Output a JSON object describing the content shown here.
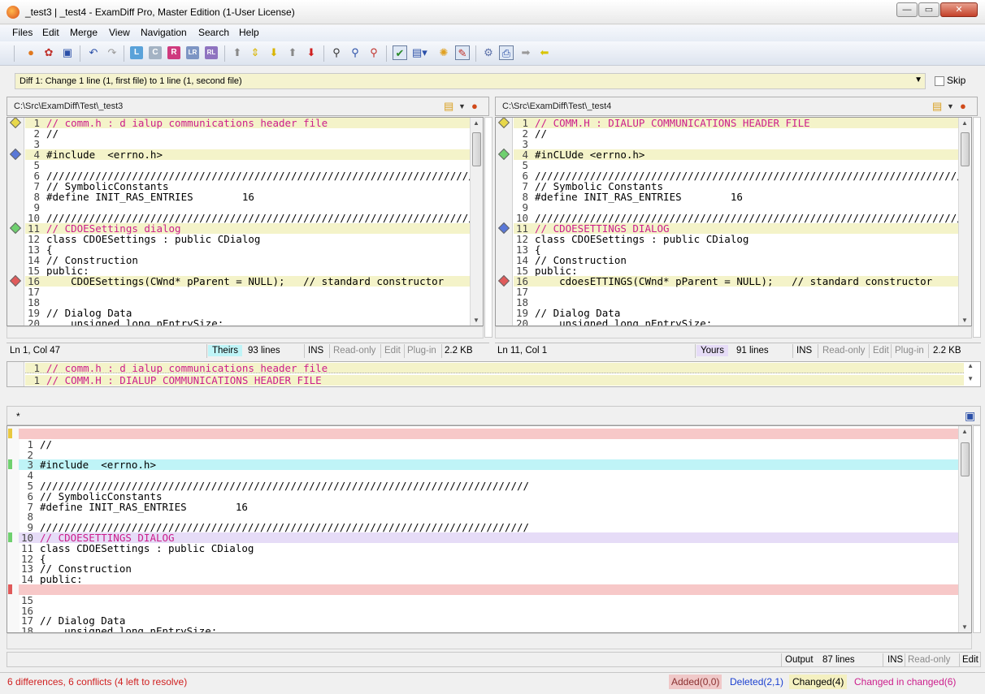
{
  "window": {
    "title": "_test3  |  _test4 - ExamDiff Pro, Master Edition (1-User License)",
    "min_glyph": "—",
    "max_glyph": "▭",
    "close_glyph": "✕"
  },
  "menu": [
    "Files",
    "Edit",
    "Merge",
    "View",
    "Navigation",
    "Search",
    "Help"
  ],
  "toolbar": {
    "icons": [
      "open-icon",
      "compare-icon",
      "save-icon",
      "undo-icon",
      "redo-icon",
      "L",
      "C",
      "R",
      "LR",
      "RL",
      "up-icon",
      "next-diff-icon",
      "down-icon",
      "first-icon",
      "last-icon",
      "find-icon",
      "find-next-icon",
      "find-prev-icon",
      "check-icon",
      "options-icon",
      "sync-icon",
      "edit-icon",
      "tools-icon",
      "print-icon",
      "right-arrow-icon",
      "left-arrow-icon"
    ],
    "box_colors": {
      "L": "#5aa2d9",
      "C": "#a4b3c4",
      "R": "#cf3a7e",
      "LR": "#7d95c4",
      "RL": "#8f73c0"
    }
  },
  "diffbar": {
    "text": "Diff 1: Change 1 line (1, first file) to 1 line (1, second file)",
    "skip_label": "Skip"
  },
  "left": {
    "path": "C:\\Src\\ExamDiff\\Test\\_test3",
    "path_bg": "#bff4f7",
    "rows": [
      {
        "n": "1",
        "t": "// comm.h : d ialup communications header file",
        "hl": "yel",
        "mag": true
      },
      {
        "n": "2",
        "t": "//",
        "hl": ""
      },
      {
        "n": "3",
        "t": "",
        "hl": ""
      },
      {
        "n": "4",
        "t": "#include  <errno.h>",
        "hl": "yel"
      },
      {
        "n": "5",
        "t": "",
        "hl": ""
      },
      {
        "n": "6",
        "t": "////////////////////////////////////////////////////////////////////////////////",
        "hl": ""
      },
      {
        "n": "7",
        "t": "// SymbolicConstants",
        "hl": ""
      },
      {
        "n": "8",
        "t": "#define INIT_RAS_ENTRIES        16",
        "hl": ""
      },
      {
        "n": "9",
        "t": "",
        "hl": ""
      },
      {
        "n": "10",
        "t": "////////////////////////////////////////////////////////////////////////////////",
        "hl": ""
      },
      {
        "n": "11",
        "t": "// CDOESettings dialog",
        "hl": "yel",
        "mag": true
      },
      {
        "n": "12",
        "t": "class CDOESettings : public CDialog",
        "hl": ""
      },
      {
        "n": "13",
        "t": "{",
        "hl": ""
      },
      {
        "n": "14",
        "t": "// Construction",
        "hl": ""
      },
      {
        "n": "15",
        "t": "public:",
        "hl": ""
      },
      {
        "n": "16",
        "t": "    CDOESettings(CWnd* pParent = NULL);   // standard constructor",
        "hl": "yel"
      },
      {
        "n": "17",
        "t": "",
        "hl": ""
      },
      {
        "n": "18",
        "t": "",
        "hl": ""
      },
      {
        "n": "19",
        "t": "// Dialog Data",
        "hl": ""
      },
      {
        "n": "20",
        "t": "    unsigned long nEntrySize;",
        "hl": ""
      }
    ],
    "status": {
      "pos": "Ln 1, Col 47",
      "label": "Theirs",
      "label_bg": "#bff4f7",
      "lines": "93 lines",
      "ins": "INS",
      "ro": "Read-only",
      "edit": "Edit",
      "plugin": "Plug-in",
      "size": "2.2 KB"
    }
  },
  "right": {
    "path": "C:\\Src\\ExamDiff\\Test\\_test4",
    "path_bg": "#e6dcf7",
    "rows": [
      {
        "n": "1",
        "t": "// COMM.H : DIALUP COMMUNICATIONS HEADER FILE",
        "hl": "yel",
        "mag": true
      },
      {
        "n": "2",
        "t": "//",
        "hl": ""
      },
      {
        "n": "3",
        "t": "",
        "hl": ""
      },
      {
        "n": "4",
        "t": "#inCLUde <errno.h>",
        "hl": "yel"
      },
      {
        "n": "5",
        "t": "",
        "hl": ""
      },
      {
        "n": "6",
        "t": "////////////////////////////////////////////////////////////////////////////////",
        "hl": ""
      },
      {
        "n": "7",
        "t": "// Symbolic Constants",
        "hl": ""
      },
      {
        "n": "8",
        "t": "#define INIT_RAS_ENTRIES        16",
        "hl": ""
      },
      {
        "n": "9",
        "t": "",
        "hl": ""
      },
      {
        "n": "10",
        "t": "////////////////////////////////////////////////////////////////////////////////",
        "hl": ""
      },
      {
        "n": "11",
        "t": "// CDOESETTINGS DIALOG",
        "hl": "yel",
        "mag": true
      },
      {
        "n": "12",
        "t": "class CDOESettings : public CDialog",
        "hl": ""
      },
      {
        "n": "13",
        "t": "{",
        "hl": ""
      },
      {
        "n": "14",
        "t": "// Construction",
        "hl": ""
      },
      {
        "n": "15",
        "t": "public:",
        "hl": ""
      },
      {
        "n": "16",
        "t": "    cdoesETTINGS(CWnd* pParent = NULL);   // standard constructor",
        "hl": "yel"
      },
      {
        "n": "17",
        "t": "",
        "hl": ""
      },
      {
        "n": "18",
        "t": "",
        "hl": ""
      },
      {
        "n": "19",
        "t": "// Dialog Data",
        "hl": ""
      },
      {
        "n": "20",
        "t": "    unsigned long nEntrySize;",
        "hl": ""
      }
    ],
    "status": {
      "pos": "Ln 11, Col 1",
      "label": "Yours",
      "label_bg": "#e6dcf7",
      "lines": "91 lines",
      "ins": "INS",
      "ro": "Read-only",
      "edit": "Edit",
      "plugin": "Plug-in",
      "size": "2.2 KB"
    }
  },
  "compare_rows": [
    {
      "n": "1",
      "t": "// comm.h : d ialup communications header file"
    },
    {
      "n": "1",
      "t": "// COMM.H : DIALUP COMMUNICATIONS HEADER FILE"
    }
  ],
  "output": {
    "tab": "*",
    "rows": [
      {
        "n": "",
        "t": "",
        "hl": "pink"
      },
      {
        "n": "1",
        "t": "//",
        "hl": ""
      },
      {
        "n": "2",
        "t": "",
        "hl": ""
      },
      {
        "n": "3",
        "t": "#include  <errno.h>",
        "hl": "cyan"
      },
      {
        "n": "4",
        "t": "",
        "hl": ""
      },
      {
        "n": "5",
        "t": "////////////////////////////////////////////////////////////////////////////////",
        "hl": ""
      },
      {
        "n": "6",
        "t": "// SymbolicConstants",
        "hl": ""
      },
      {
        "n": "7",
        "t": "#define INIT_RAS_ENTRIES        16",
        "hl": ""
      },
      {
        "n": "8",
        "t": "",
        "hl": ""
      },
      {
        "n": "9",
        "t": "////////////////////////////////////////////////////////////////////////////////",
        "hl": ""
      },
      {
        "n": "10",
        "t": "// CDOESETTINGS DIALOG",
        "hl": "lav",
        "mag": true
      },
      {
        "n": "11",
        "t": "class CDOESettings : public CDialog",
        "hl": ""
      },
      {
        "n": "12",
        "t": "{",
        "hl": ""
      },
      {
        "n": "13",
        "t": "// Construction",
        "hl": ""
      },
      {
        "n": "14",
        "t": "public:",
        "hl": ""
      },
      {
        "n": "",
        "t": "",
        "hl": "pink"
      },
      {
        "n": "15",
        "t": "",
        "hl": ""
      },
      {
        "n": "16",
        "t": "",
        "hl": ""
      },
      {
        "n": "17",
        "t": "// Dialog Data",
        "hl": ""
      },
      {
        "n": "18",
        "t": "    unsigned long nEntrySize;",
        "hl": ""
      }
    ],
    "status": {
      "label": "Output",
      "lines": "87 lines",
      "ins": "INS",
      "ro": "Read-only",
      "edit": "Edit"
    }
  },
  "bottom": {
    "summary": "6 differences, 6 conflicts (4 left to resolve)",
    "summary_color": "#d02020",
    "added": "Added(0,0)",
    "added_bg": "#f0c8c8",
    "deleted": "Deleted(2,1)",
    "deleted_color": "#1a3fd0",
    "changed": "Changed(4)",
    "changed_bg": "#f4f0c0",
    "cic": "Changed in changed(6)",
    "cic_color": "#cc1e8c"
  }
}
